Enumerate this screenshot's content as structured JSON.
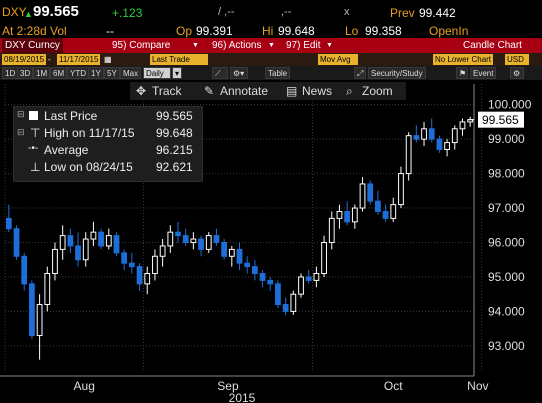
{
  "quote": {
    "ticker": "DXY",
    "last": "99.565",
    "change": "+.123",
    "pair1": "/ ,--",
    "pair2": ",--",
    "xmark": "x",
    "prev_label": "Prev",
    "prev": "99.442",
    "time_label": "At 2:28d Vol",
    "vol": "--",
    "open_label": "Op",
    "open": "99.391",
    "high_label": "Hi",
    "high": "99.648",
    "low_label": "Lo",
    "low": "99.358",
    "openint_label": "OpenIn"
  },
  "menu": {
    "security": "DXY Curncy",
    "compare": "Compare",
    "actions": "Actions",
    "edit": "Edit",
    "chart_type": "Candle Chart",
    "compare_num": "95)",
    "actions_num": "96)",
    "edit_num": "97)"
  },
  "controls": {
    "start_date": "08/19/2015",
    "end_date": "11/17/2015",
    "field": "Last Trade",
    "mov_avg": "Mov Avg",
    "lower_chart": "No Lower Chart",
    "currency": "USD"
  },
  "toolbar": {
    "periods": [
      "1D",
      "3D",
      "1M",
      "6M",
      "YTD",
      "1Y",
      "5Y",
      "Max"
    ],
    "frequency": "Daily",
    "table": "Table",
    "security_study": "Security/Study",
    "event": "Event"
  },
  "chart_tools": {
    "track": "Track",
    "annotate": "Annotate",
    "news": "News",
    "zoom": "Zoom"
  },
  "legend": {
    "last_label": "Last Price",
    "last_value": "99.565",
    "high_label": "High on 11/17/15",
    "high_value": "99.648",
    "avg_label": "Average",
    "avg_value": "96.215",
    "low_label": "Low on 08/24/15",
    "low_value": "92.621"
  },
  "chart_data": {
    "type": "candlestick",
    "y_ticks": [
      "100.000",
      "99.000",
      "98.000",
      "97.000",
      "96.000",
      "95.000",
      "94.000",
      "93.000"
    ],
    "y_ticks_values": [
      100,
      99,
      98,
      97,
      96,
      95,
      94,
      93
    ],
    "ylim": [
      92.3,
      100.6
    ],
    "x_tick_labels": [
      "Aug",
      "Sep",
      "Oct",
      "Nov"
    ],
    "x_tick_days": [
      0,
      18,
      40,
      62
    ],
    "year_label": "2015",
    "last_price_label": "99.565",
    "last_price": 99.565,
    "colors": {
      "up": "#ffffff",
      "down": "#1e6ed8",
      "grid": "#3a3a3a",
      "axis_text": "#dddddd"
    },
    "candles": [
      [
        96.7,
        97.1,
        96.3,
        96.4
      ],
      [
        96.4,
        96.5,
        95.5,
        95.6
      ],
      [
        95.6,
        95.7,
        94.6,
        94.8
      ],
      [
        94.8,
        94.9,
        93.2,
        93.3
      ],
      [
        93.3,
        94.5,
        92.6,
        94.2
      ],
      [
        94.2,
        95.3,
        94.0,
        95.1
      ],
      [
        95.1,
        96.0,
        94.9,
        95.8
      ],
      [
        95.8,
        96.5,
        95.5,
        96.2
      ],
      [
        96.2,
        96.4,
        95.7,
        95.9
      ],
      [
        95.9,
        96.3,
        95.3,
        95.5
      ],
      [
        95.5,
        96.3,
        95.3,
        96.1
      ],
      [
        96.1,
        96.6,
        95.9,
        96.3
      ],
      [
        96.3,
        96.4,
        95.8,
        95.9
      ],
      [
        95.9,
        96.4,
        95.8,
        96.2
      ],
      [
        96.2,
        96.3,
        95.6,
        95.7
      ],
      [
        95.7,
        95.8,
        95.2,
        95.4
      ],
      [
        95.4,
        95.7,
        95.1,
        95.3
      ],
      [
        95.3,
        95.4,
        94.6,
        94.8
      ],
      [
        94.8,
        95.3,
        94.5,
        95.1
      ],
      [
        95.1,
        95.8,
        94.9,
        95.6
      ],
      [
        95.6,
        96.1,
        95.3,
        95.9
      ],
      [
        95.9,
        96.5,
        95.7,
        96.3
      ],
      [
        96.3,
        96.6,
        96.0,
        96.2
      ],
      [
        96.2,
        96.4,
        95.9,
        96.0
      ],
      [
        96.0,
        96.3,
        95.8,
        96.1
      ],
      [
        96.1,
        96.2,
        95.6,
        95.8
      ],
      [
        95.8,
        96.3,
        95.7,
        96.2
      ],
      [
        96.2,
        96.4,
        95.9,
        96.0
      ],
      [
        96.0,
        96.1,
        95.5,
        95.6
      ],
      [
        95.6,
        95.9,
        95.3,
        95.8
      ],
      [
        95.8,
        96.0,
        95.2,
        95.4
      ],
      [
        95.4,
        95.6,
        95.1,
        95.3
      ],
      [
        95.3,
        95.5,
        94.9,
        95.1
      ],
      [
        95.1,
        95.2,
        94.7,
        94.9
      ],
      [
        94.9,
        95.0,
        94.6,
        94.8
      ],
      [
        94.8,
        94.9,
        94.1,
        94.2
      ],
      [
        94.2,
        94.4,
        93.9,
        94.0
      ],
      [
        94.0,
        94.6,
        93.9,
        94.5
      ],
      [
        94.5,
        95.1,
        94.4,
        95.0
      ],
      [
        95.0,
        95.2,
        94.8,
        94.9
      ],
      [
        94.9,
        95.3,
        94.7,
        95.1
      ],
      [
        95.1,
        96.2,
        95.0,
        96.0
      ],
      [
        96.0,
        96.9,
        95.8,
        96.7
      ],
      [
        96.7,
        97.1,
        96.4,
        96.9
      ],
      [
        96.9,
        97.2,
        96.5,
        96.6
      ],
      [
        96.6,
        97.1,
        96.4,
        97.0
      ],
      [
        97.0,
        97.9,
        96.9,
        97.7
      ],
      [
        97.7,
        97.8,
        97.1,
        97.2
      ],
      [
        97.2,
        97.5,
        96.8,
        96.9
      ],
      [
        96.9,
        97.1,
        96.6,
        96.7
      ],
      [
        96.7,
        97.3,
        96.6,
        97.1
      ],
      [
        97.1,
        98.2,
        97.0,
        98.0
      ],
      [
        98.0,
        99.2,
        97.8,
        99.1
      ],
      [
        99.1,
        99.4,
        98.9,
        99.0
      ],
      [
        99.0,
        99.5,
        98.8,
        99.3
      ],
      [
        99.3,
        99.6,
        98.9,
        99.0
      ],
      [
        99.0,
        99.1,
        98.6,
        98.7
      ],
      [
        98.7,
        99.0,
        98.5,
        98.9
      ],
      [
        98.9,
        99.4,
        98.7,
        99.3
      ],
      [
        99.3,
        99.6,
        99.1,
        99.5
      ],
      [
        99.5,
        99.65,
        99.36,
        99.565
      ]
    ]
  }
}
